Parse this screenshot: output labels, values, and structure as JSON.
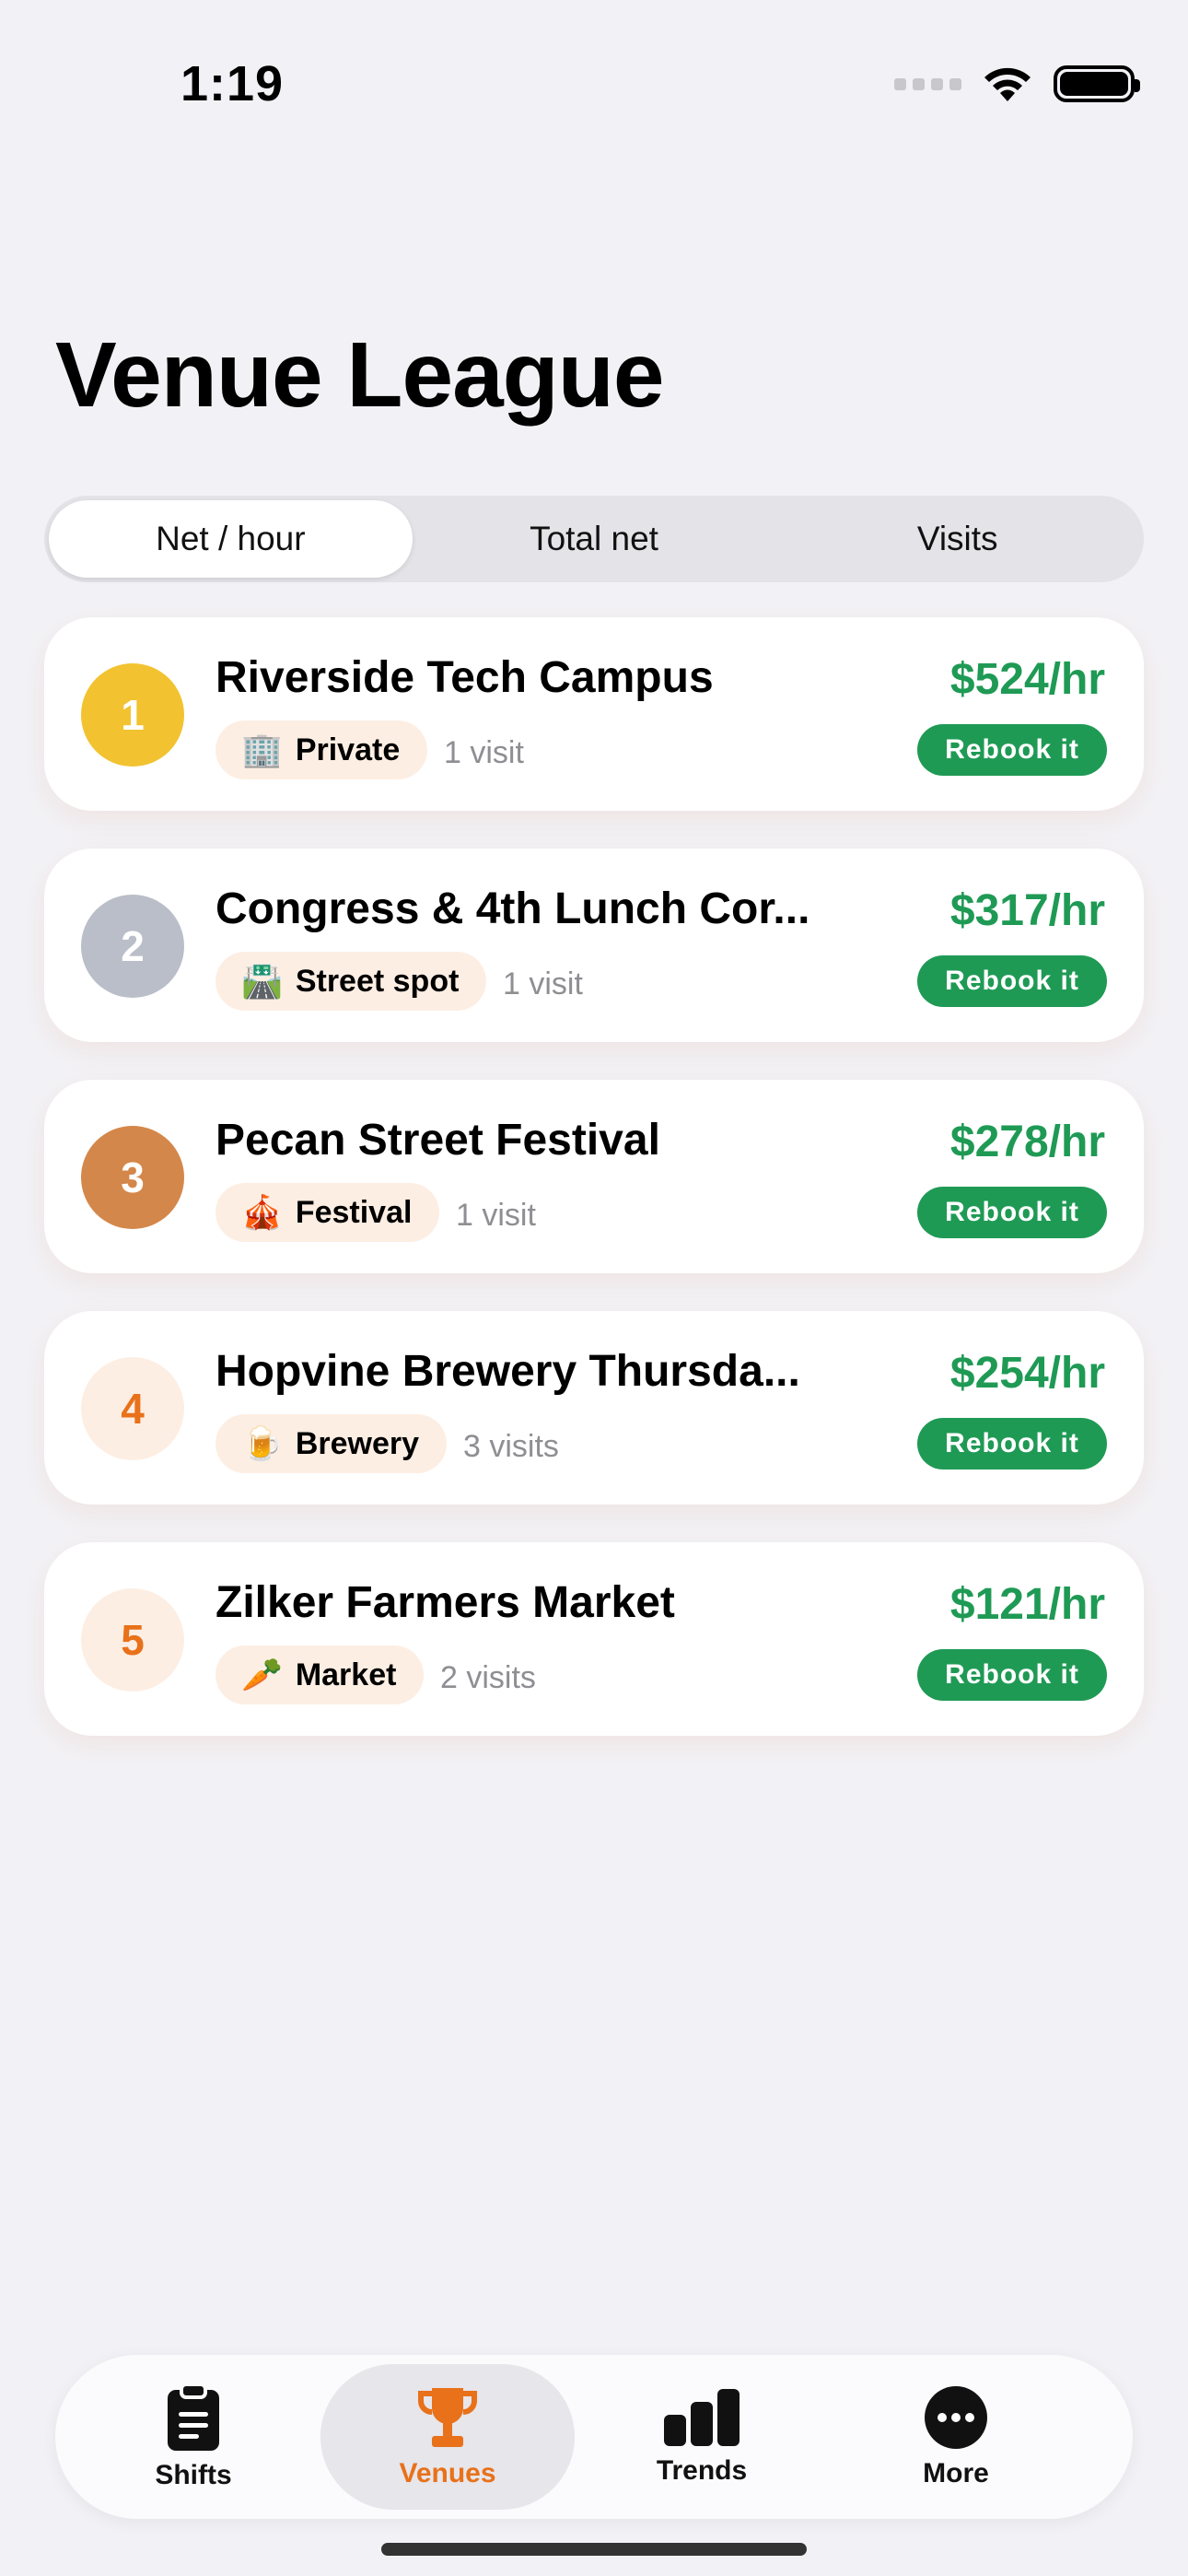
{
  "status": {
    "time": "1:19"
  },
  "title": "Venue League",
  "segments": [
    {
      "label": "Net / hour",
      "selected": true
    },
    {
      "label": "Total net",
      "selected": false
    },
    {
      "label": "Visits",
      "selected": false
    }
  ],
  "venues": [
    {
      "rank": "1",
      "rank_color": "#f2c230",
      "rank_text_color": "#ffffff",
      "name": "Riverside Tech Campus",
      "type_icon": "🏢",
      "type": "Private",
      "visits": "1 visit",
      "rate": "$524/hr",
      "action": "Rebook it"
    },
    {
      "rank": "2",
      "rank_color": "#b9bec8",
      "rank_text_color": "#ffffff",
      "name": "Congress & 4th Lunch Cor...",
      "type_icon": "🛣️",
      "type": "Street spot",
      "visits": "1 visit",
      "rate": "$317/hr",
      "action": "Rebook it"
    },
    {
      "rank": "3",
      "rank_color": "#d4874a",
      "rank_text_color": "#ffffff",
      "name": "Pecan Street Festival",
      "type_icon": "🎪",
      "type": "Festival",
      "visits": "1 visit",
      "rate": "$278/hr",
      "action": "Rebook it"
    },
    {
      "rank": "4",
      "rank_color": "#fdeee3",
      "rank_text_color": "#e8711a",
      "name": "Hopvine Brewery Thursda...",
      "type_icon": "🍺",
      "type": "Brewery",
      "visits": "3 visits",
      "rate": "$254/hr",
      "action": "Rebook it"
    },
    {
      "rank": "5",
      "rank_color": "#fdeee3",
      "rank_text_color": "#e8711a",
      "name": "Zilker Farmers Market",
      "type_icon": "🥕",
      "type": "Market",
      "visits": "2 visits",
      "rate": "$121/hr",
      "action": "Rebook it"
    }
  ],
  "tabs": [
    {
      "label": "Shifts",
      "icon": "clipboard-icon",
      "active": false
    },
    {
      "label": "Venues",
      "icon": "trophy-icon",
      "active": true
    },
    {
      "label": "Trends",
      "icon": "bar-chart-icon",
      "active": false
    },
    {
      "label": "More",
      "icon": "more-icon",
      "active": false
    }
  ],
  "colors": {
    "accent": "#e8711a",
    "positive": "#1f9a55",
    "background": "#f2f2f6"
  }
}
